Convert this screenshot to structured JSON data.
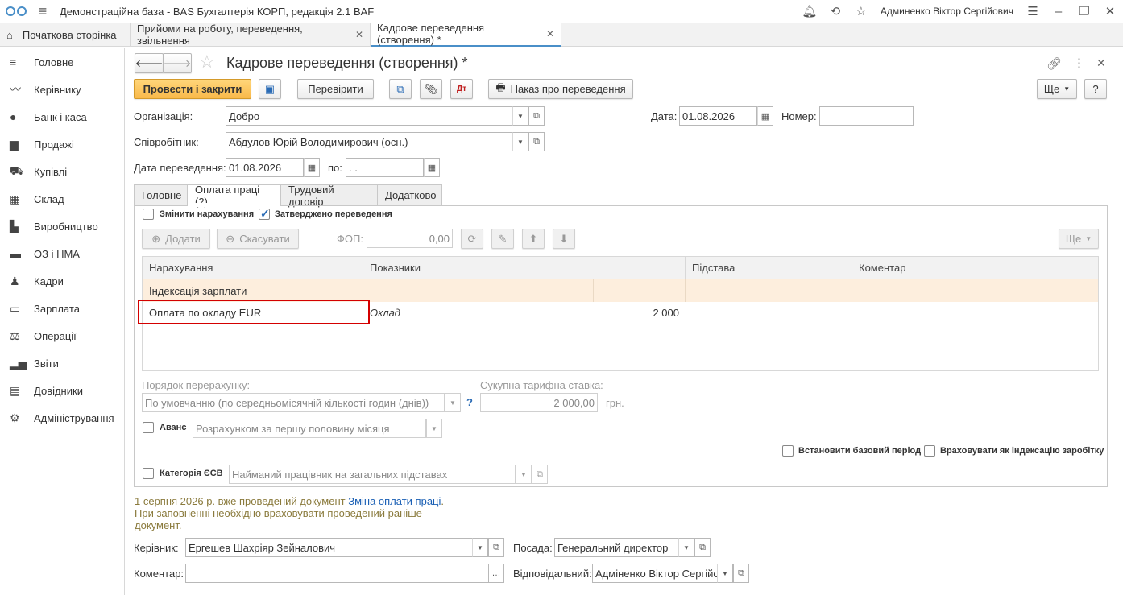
{
  "app": {
    "title": "Демонстраційна база - BAS Бухгалтерія КОРП, редакція 2.1 BAF",
    "user": "Админенко Віктор Сергійович"
  },
  "tabs": [
    {
      "label": "Початкова сторінка"
    },
    {
      "label": "Прийоми на роботу, переведення, звільнення"
    },
    {
      "label": "Кадрове переведення (створення) *"
    }
  ],
  "sidebar": {
    "items": [
      {
        "label": "Головне",
        "icon": "menu-icon"
      },
      {
        "label": "Керівнику",
        "icon": "trend-icon"
      },
      {
        "label": "Банк і каса",
        "icon": "coin-icon"
      },
      {
        "label": "Продажі",
        "icon": "bag-icon"
      },
      {
        "label": "Купівлі",
        "icon": "cart-icon"
      },
      {
        "label": "Склад",
        "icon": "grid-icon"
      },
      {
        "label": "Виробництво",
        "icon": "factory-icon"
      },
      {
        "label": "ОЗ і НМА",
        "icon": "truck-icon"
      },
      {
        "label": "Кадри",
        "icon": "person-icon"
      },
      {
        "label": "Зарплата",
        "icon": "card-icon"
      },
      {
        "label": "Операції",
        "icon": "ops-icon"
      },
      {
        "label": "Звіти",
        "icon": "bar-chart-icon"
      },
      {
        "label": "Довідники",
        "icon": "book-icon"
      },
      {
        "label": "Адміністрування",
        "icon": "gear-icon"
      }
    ]
  },
  "form": {
    "title": "Кадрове переведення (створення) *",
    "buttons": {
      "post_close": "Провести і закрити",
      "check": "Перевірити",
      "order": "Наказ про переведення",
      "more": "Ще",
      "help": "?"
    },
    "org_label": "Організація:",
    "org_value": "Добро",
    "date_label": "Дата:",
    "date_value": "01.08.2026",
    "number_label": "Номер:",
    "number_value": "",
    "employee_label": "Співробітник:",
    "employee_value": "Абдулов Юрій Володимирович (осн.)",
    "transfer_date_label": "Дата переведення:",
    "transfer_date_value": "01.08.2026",
    "to_label": "по:",
    "to_value": " .  ."
  },
  "page_tabs": [
    {
      "label": "Головне"
    },
    {
      "label": "Оплата праці (2)"
    },
    {
      "label": "Трудовий договір"
    },
    {
      "label": "Додатково"
    }
  ],
  "pay": {
    "change_accruals": "Змінити нарахування",
    "approved": "Затверджено переведення",
    "add": "Додати",
    "cancel": "Скасувати",
    "fop_label": "ФОП:",
    "fop_value": "0,00",
    "more": "Ще",
    "columns": [
      "Нарахування",
      "Показники",
      "Підстава",
      "Коментар"
    ],
    "rows": [
      {
        "accrual": "Індексація зарплати",
        "indicator": "",
        "value": ""
      },
      {
        "accrual": "Оплата по окладу EUR",
        "indicator": "Оклад",
        "value": "2 000"
      }
    ],
    "recalc_label": "Порядок перерахунку:",
    "recalc_value": "По умовчанню (по середньомісячній кількості годин (днів))",
    "help": "?",
    "total_rate_label": "Сукупна тарифна ставка:",
    "total_rate_value": "2 000,00",
    "currency": "грн.",
    "advance_label": "Аванс",
    "advance_value": "Розрахунком за першу половину місяця",
    "base_period": "Встановити базовий період",
    "indexation": "Враховувати як індексацію заробітку",
    "esv_label": "Категорія ЄСВ",
    "esv_value": "Найманий працівник на загальних підставах"
  },
  "notice": {
    "text1": "1 серпня 2026 р. вже проведений документ ",
    "link": "Зміна оплати праці",
    "text2": ".",
    "line2": "При заповненні необхідно враховувати проведений раніше",
    "line3": "документ."
  },
  "footer": {
    "head_label": "Керівник:",
    "head_value": "Ергешев Шахріяр Зейналович",
    "position_label": "Посада:",
    "position_value": "Генеральний директор",
    "comment_label": "Коментар:",
    "comment_value": "",
    "responsible_label": "Відповідальний:",
    "responsible_value": "Адміненко Віктор Сергійо"
  },
  "colors": {
    "accent": "#4a8fc8",
    "primary_btn": "#f9b94a",
    "highlight_row": "#fdeedd",
    "selection_border": "#d40000"
  }
}
